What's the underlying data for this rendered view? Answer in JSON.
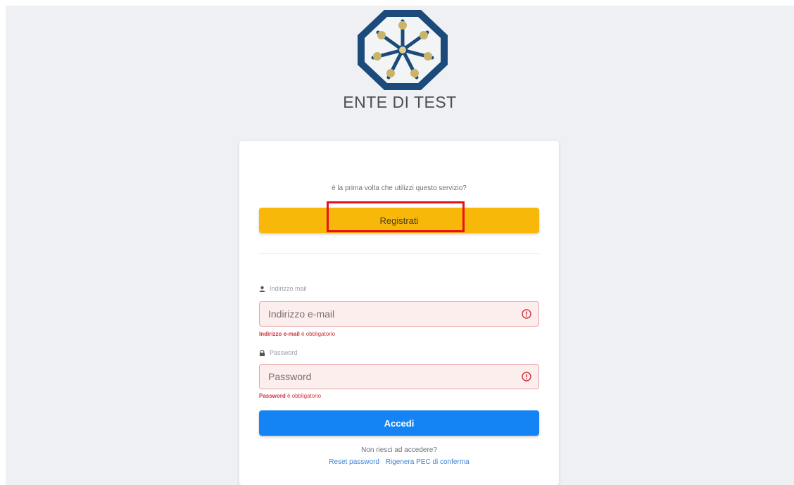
{
  "header": {
    "entity_name": "ENTE DI TEST"
  },
  "register": {
    "prompt": "è la prima volta che utilizzi questo servizio?",
    "button_label": "Registrati"
  },
  "email": {
    "label": "Indirizzo mail",
    "placeholder": "Indirizzo e-mail",
    "error_field": "Indirizzo e-mail",
    "error_suffix": " è obbligatorio"
  },
  "password": {
    "label": "Password",
    "placeholder": "Password",
    "error_field": "Password",
    "error_suffix": " è obbligatorio"
  },
  "login": {
    "button_label": "Accedi"
  },
  "help": {
    "cant_access": "Non riesci ad accedere?",
    "reset_password": "Reset password",
    "regenerate_pec": "Rigenera PEC di conferma"
  },
  "colors": {
    "register_button": "#f8b80a",
    "login_button": "#1484f5",
    "error": "#d0313b",
    "logo_blue": "#1c4a7a",
    "highlight": "#e8101b"
  }
}
